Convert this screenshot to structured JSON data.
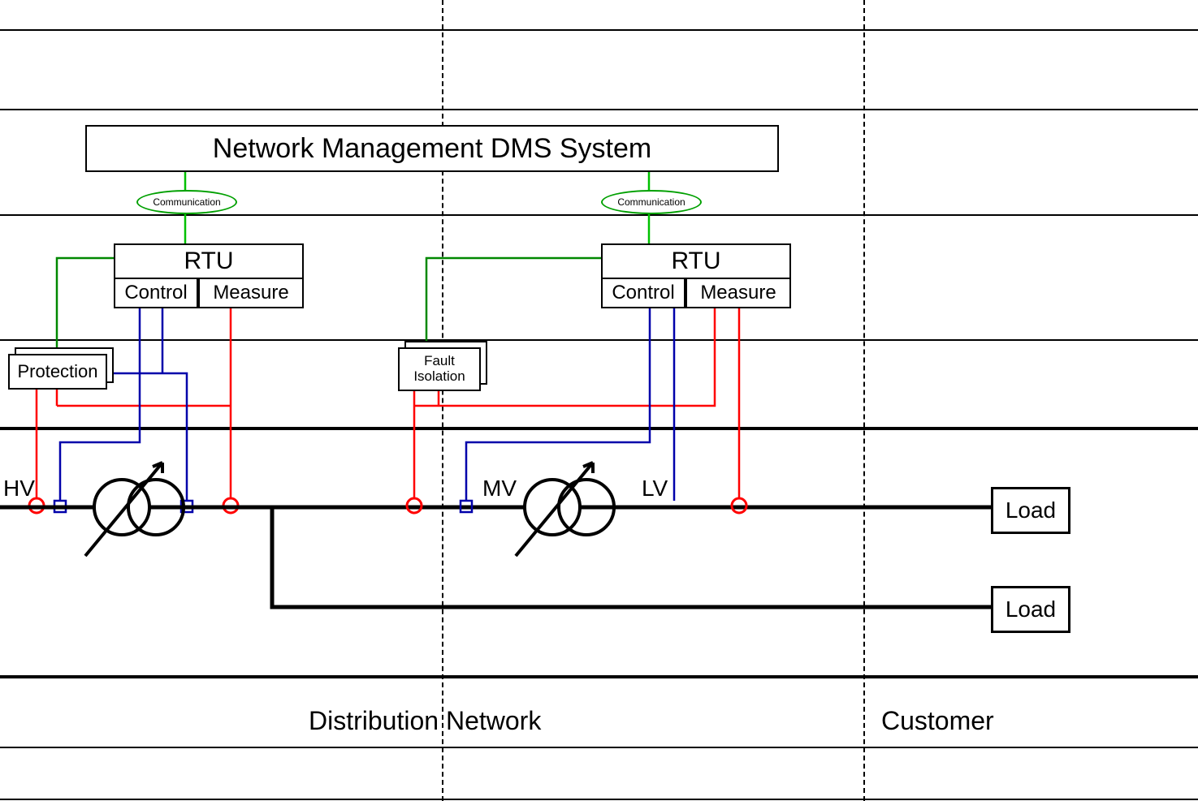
{
  "title": "Network Management DMS System",
  "rtu": {
    "label": "RTU",
    "control": "Control",
    "measure": "Measure"
  },
  "comm": "Communication",
  "protection": "Protection",
  "fault_isolation_1": "Fault",
  "fault_isolation_2": "Isolation",
  "voltage": {
    "hv": "HV",
    "mv": "MV",
    "lv": "LV"
  },
  "load": "Load",
  "captions": {
    "dist": "Distribution Network",
    "cust": "Customer"
  },
  "colors": {
    "red": "#ff0000",
    "blue": "#0000aa",
    "green": "#008800",
    "bright_green": "#00c000",
    "black": "#000000"
  }
}
